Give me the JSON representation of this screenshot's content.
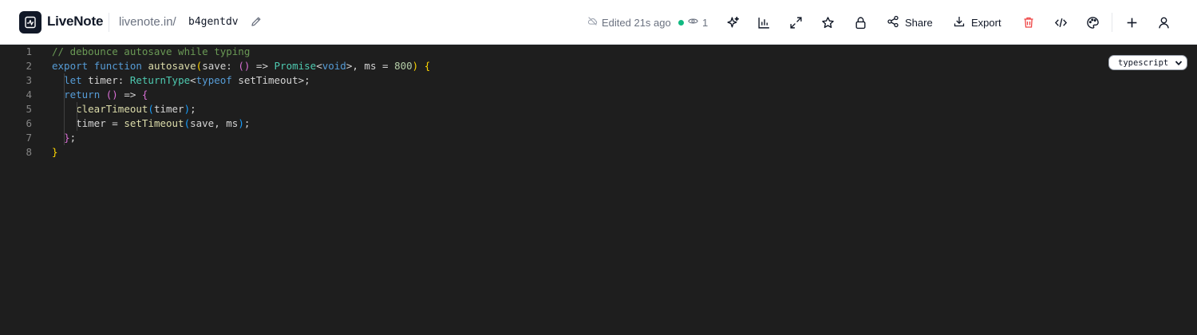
{
  "app": {
    "name": "LiveNote",
    "url_prefix": "livenote.in/",
    "note_id": "b4gentdv"
  },
  "status": {
    "edited": "Edited 21s ago",
    "viewers": "1",
    "online_color": "#10b981"
  },
  "toolbar": {
    "share_label": "Share",
    "export_label": "Export",
    "icons": [
      "sparkle-icon",
      "chart-icon",
      "expand-icon",
      "star-icon",
      "lock-icon",
      "share-icon",
      "download-icon",
      "trash-icon",
      "code-icon",
      "palette-icon",
      "plus-icon",
      "user-icon"
    ]
  },
  "editor": {
    "language": "typescript",
    "line_numbers": [
      "1",
      "2",
      "3",
      "4",
      "5",
      "6",
      "7",
      "8"
    ],
    "lines": [
      [
        {
          "t": "// debounce autosave while typing",
          "c": "c-comment"
        }
      ],
      [
        {
          "t": "export",
          "c": "c-kw"
        },
        {
          "t": " "
        },
        {
          "t": "function",
          "c": "c-kw"
        },
        {
          "t": " "
        },
        {
          "t": "autosave",
          "c": "c-fn"
        },
        {
          "t": "(",
          "c": "c-b1"
        },
        {
          "t": "save: "
        },
        {
          "t": "()",
          "c": "c-b2"
        },
        {
          "t": " => "
        },
        {
          "t": "Promise",
          "c": "c-type"
        },
        {
          "t": "<"
        },
        {
          "t": "void",
          "c": "c-kw"
        },
        {
          "t": ">, ms = "
        },
        {
          "t": "800",
          "c": "c-num"
        },
        {
          "t": ")",
          "c": "c-b1"
        },
        {
          "t": " "
        },
        {
          "t": "{",
          "c": "c-b1"
        }
      ],
      [
        {
          "t": "  "
        },
        {
          "t": "let",
          "c": "c-kw"
        },
        {
          "t": " timer: "
        },
        {
          "t": "ReturnType",
          "c": "c-type"
        },
        {
          "t": "<"
        },
        {
          "t": "typeof",
          "c": "c-kw"
        },
        {
          "t": " setTimeout>;"
        }
      ],
      [
        {
          "t": "  "
        },
        {
          "t": "return",
          "c": "c-kw"
        },
        {
          "t": " "
        },
        {
          "t": "()",
          "c": "c-b2"
        },
        {
          "t": " => "
        },
        {
          "t": "{",
          "c": "c-b2"
        }
      ],
      [
        {
          "t": "    "
        },
        {
          "t": "clearTimeout",
          "c": "c-fn"
        },
        {
          "t": "(",
          "c": "c-b3"
        },
        {
          "t": "timer"
        },
        {
          "t": ")",
          "c": "c-b3"
        },
        {
          "t": ";"
        }
      ],
      [
        {
          "t": "    timer = "
        },
        {
          "t": "setTimeout",
          "c": "c-fn"
        },
        {
          "t": "(",
          "c": "c-b3"
        },
        {
          "t": "save, ms"
        },
        {
          "t": ")",
          "c": "c-b3"
        },
        {
          "t": ";"
        }
      ],
      [
        {
          "t": "  "
        },
        {
          "t": "}",
          "c": "c-b2"
        },
        {
          "t": ";"
        }
      ],
      [
        {
          "t": "}",
          "c": "c-b1"
        }
      ]
    ]
  }
}
